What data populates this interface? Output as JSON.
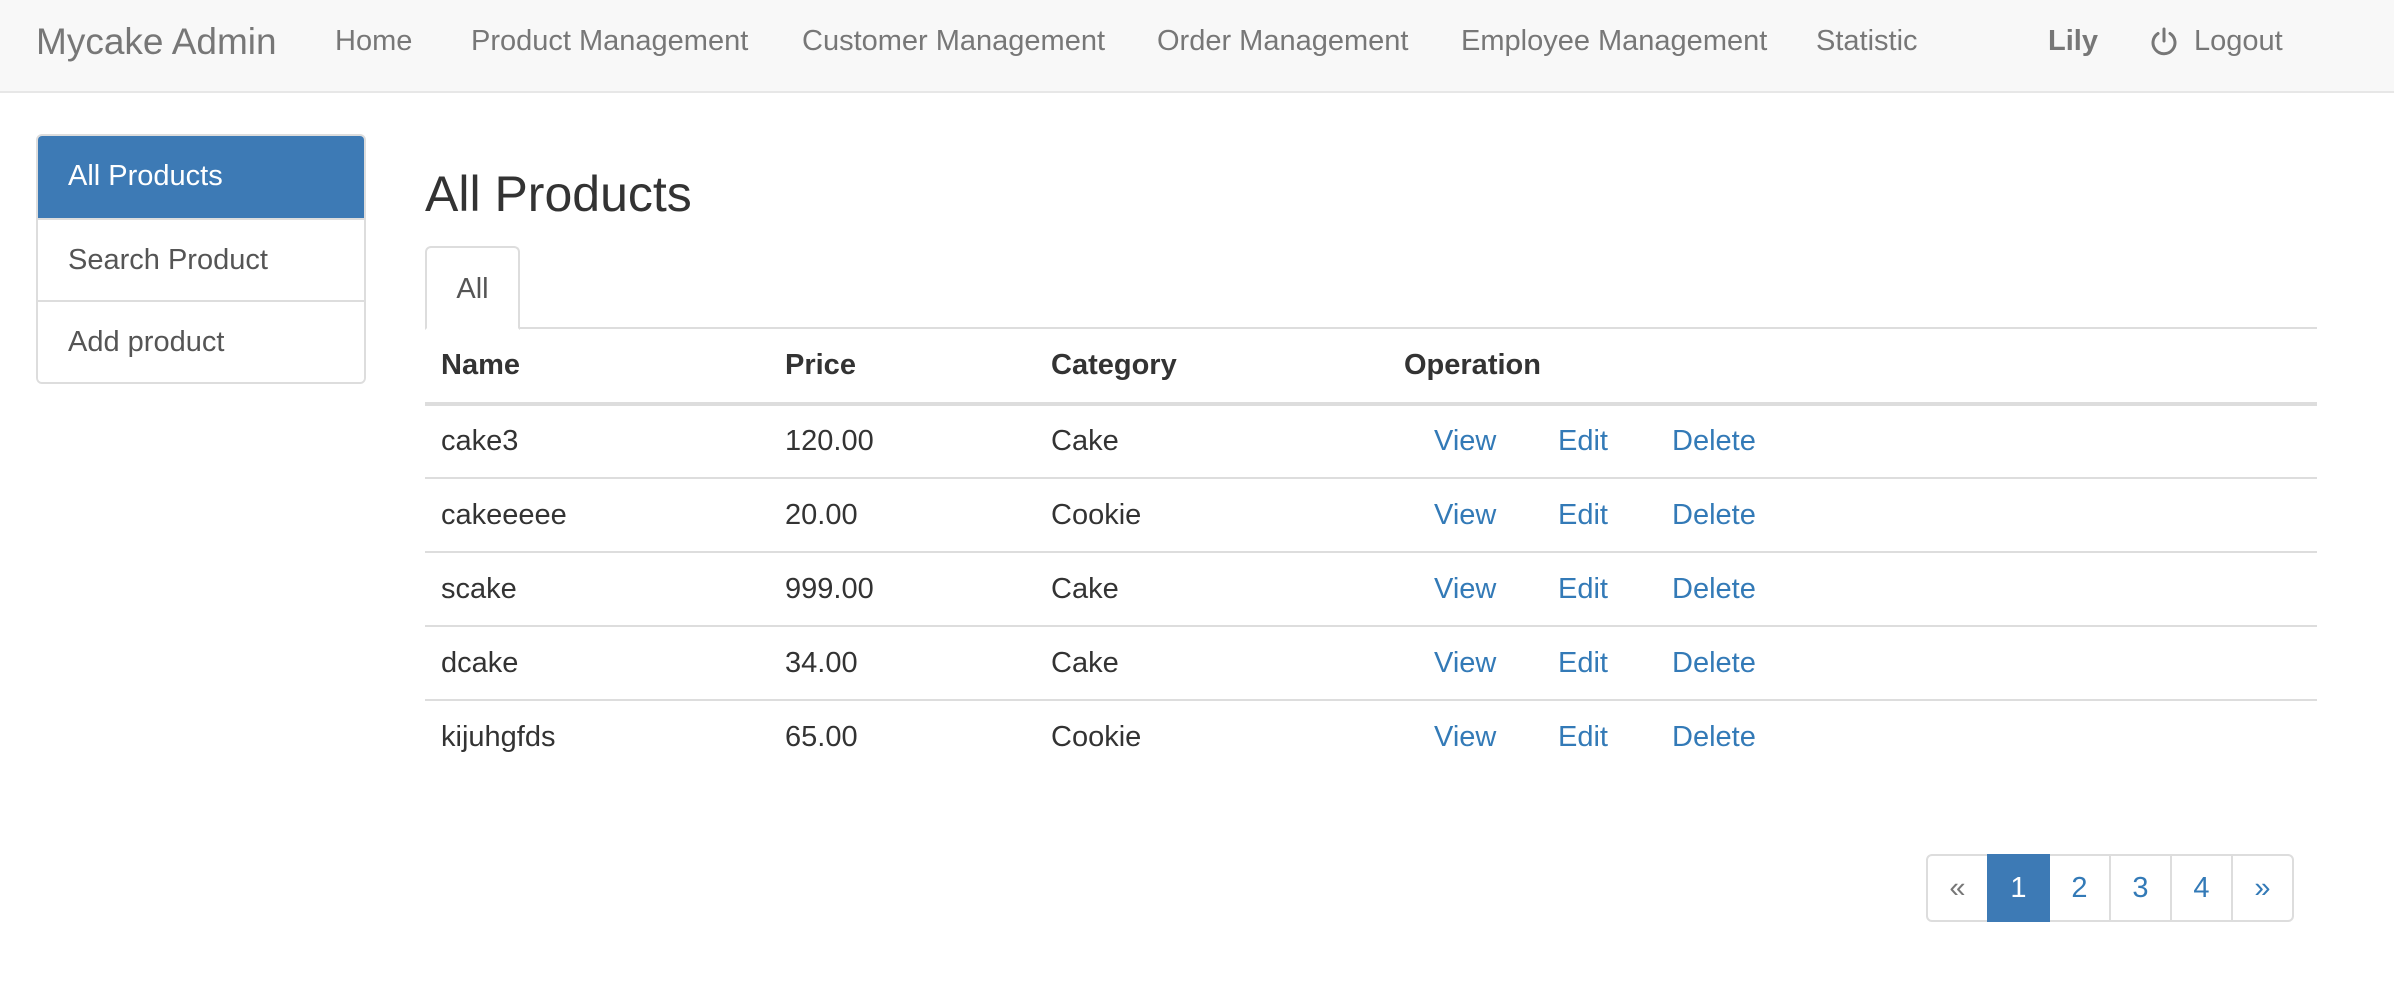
{
  "navbar": {
    "brand": "Mycake Admin",
    "links": [
      "Home",
      "Product Management",
      "Customer Management",
      "Order Management",
      "Employee Management",
      "Statistic"
    ],
    "user": "Lily",
    "logout_label": "Logout",
    "logout_icon": "power-icon"
  },
  "sidebar": {
    "items": [
      {
        "label": "All Products",
        "active": true
      },
      {
        "label": "Search Product",
        "active": false
      },
      {
        "label": "Add product",
        "active": false
      }
    ]
  },
  "main": {
    "title": "All Products",
    "tabs": [
      {
        "label": "All"
      }
    ],
    "table": {
      "headers": [
        "Name",
        "Price",
        "Category",
        "Operation"
      ],
      "rows": [
        {
          "name": "cake3",
          "price": "120.00",
          "category": "Cake"
        },
        {
          "name": "cakeeeee",
          "price": "20.00",
          "category": "Cookie"
        },
        {
          "name": "scake",
          "price": "999.00",
          "category": "Cake"
        },
        {
          "name": "dcake",
          "price": "34.00",
          "category": "Cake"
        },
        {
          "name": "kijuhgfds",
          "price": "65.00",
          "category": "Cookie"
        }
      ],
      "operations": {
        "view": "View",
        "edit": "Edit",
        "delete": "Delete"
      }
    },
    "pagination": {
      "prev": "«",
      "pages": [
        "1",
        "2",
        "3",
        "4"
      ],
      "current": "1",
      "next": "»"
    }
  },
  "colors": {
    "primary": "#3d7ab5",
    "link": "#337ab7",
    "navbar_bg": "#f8f8f8",
    "navbar_text": "#777777"
  }
}
